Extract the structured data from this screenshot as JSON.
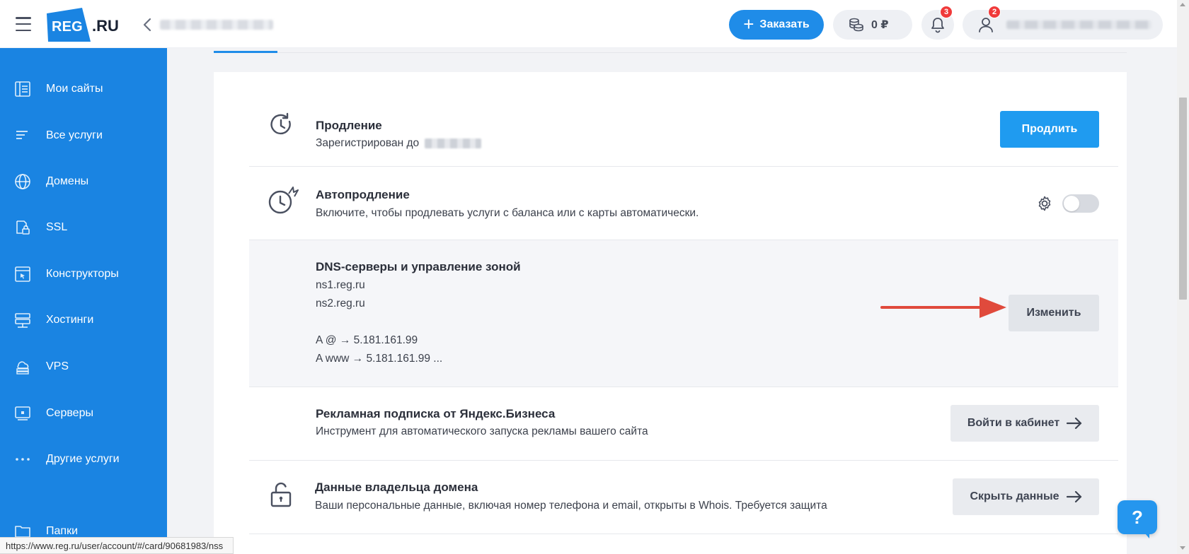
{
  "header": {
    "logo_text": "REG",
    "logo_suffix": ".RU",
    "order_label": "Заказать",
    "balance": "0 ₽",
    "notifications_count": "3",
    "profile_count": "2"
  },
  "sidebar": {
    "items": [
      {
        "label": "Мои сайты",
        "icon": "sites-icon"
      },
      {
        "label": "Все услуги",
        "icon": "list-icon"
      },
      {
        "label": "Домены",
        "icon": "globe-icon"
      },
      {
        "label": "SSL",
        "icon": "ssl-lock-icon"
      },
      {
        "label": "Конструкторы",
        "icon": "constructor-icon"
      },
      {
        "label": "Хостинги",
        "icon": "hosting-icon"
      },
      {
        "label": "VPS",
        "icon": "vps-cloud-icon"
      },
      {
        "label": "Серверы",
        "icon": "server-icon"
      },
      {
        "label": "Другие услуги",
        "icon": "more-dots-icon"
      },
      {
        "label": "Папки",
        "icon": "folder-icon"
      }
    ]
  },
  "sections": {
    "renewal": {
      "title": "Продление",
      "subtitle": "Зарегистрирован до",
      "button": "Продлить"
    },
    "autorenewal": {
      "title": "Автопродление",
      "subtitle": "Включите, чтобы продлевать услуги с баланса или с карты автоматически.",
      "enabled": false
    },
    "dns": {
      "title": "DNS-серверы и управление зоной",
      "ns1": "ns1.reg.ru",
      "ns2": "ns2.reg.ru",
      "record1": "A @ → 5.181.161.99",
      "record2": "A www → 5.181.161.99 ...",
      "button": "Изменить"
    },
    "ads": {
      "title": "Рекламная подписка от Яндекс.Бизнеса",
      "subtitle": "Инструмент для автоматического запуска рекламы вашего сайта",
      "button": "Войти в кабинет"
    },
    "owner": {
      "title": "Данные владельца домена",
      "subtitle": "Ваши персональные данные, включая номер телефона и email, открыты в Whois. Требуется защита",
      "button": "Скрыть данные"
    }
  },
  "help_label": "?",
  "statusbar_url": "https://www.reg.ru/user/account/#/card/90681983/nss",
  "colors": {
    "sidebar": "#1a84e2",
    "primary": "#1f9bf0",
    "badge": "#f03a3a",
    "arrow": "#e04a3c"
  }
}
